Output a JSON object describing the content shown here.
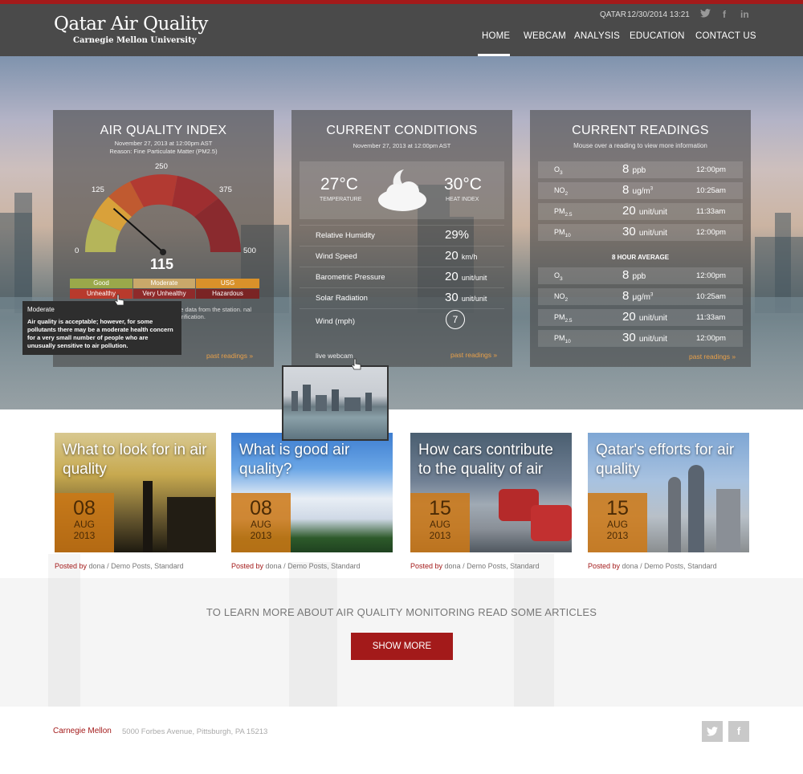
{
  "header": {
    "logo_title": "Qatar Air Quality",
    "logo_subtitle": "Carnegie Mellon University",
    "country": "QATAR",
    "datetime": "12/30/2014  13:21",
    "nav": [
      "HOME",
      "WEBCAM",
      "ANALYSIS",
      "EDUCATION",
      "CONTACT US"
    ],
    "active_nav": "HOME",
    "social_icons": [
      "twitter-icon",
      "facebook-icon",
      "linkedin-icon"
    ]
  },
  "aqi_panel": {
    "title": "AIR QUALITY INDEX",
    "date": "November 27, 2013 at 12:00pm AST",
    "reason": "Reason: Fine Particulate Matter (PM2.5)",
    "gauge_ticks": [
      "0",
      "125",
      "250",
      "375",
      "500"
    ],
    "value": "115",
    "value_number": 115,
    "gauge_max": 500,
    "legend": [
      {
        "label": "Good",
        "color": "#9aa84a"
      },
      {
        "label": "Moderate",
        "color": "#c9a86a"
      },
      {
        "label": "USG",
        "color": "#d9912a"
      },
      {
        "label": "Unhealthy",
        "color": "#b83a2c"
      },
      {
        "label": "Very Unhealthy",
        "color": "#8e2a2a"
      },
      {
        "label": "Hazardous",
        "color": "#7a2424"
      }
    ],
    "background_text": "me data from the station. nal verification.",
    "past_readings": "past readings »"
  },
  "tooltip": {
    "title": "Moderate",
    "body": "Air quality is acceptable; however, for some pollutants there may be a moderate health concern for a very small number of people who are unusually sensitive to air pollution."
  },
  "conditions_panel": {
    "title": "CURRENT CONDITIONS",
    "date": "November 27, 2013 at 12:00pm AST",
    "temperature": "27°C",
    "temperature_label": "TEMPERATURE",
    "heat_index": "30°C",
    "heat_index_label": "HEAT INDEX",
    "weather_icon": "moon-cloud-icon",
    "rows": [
      {
        "name": "Relative Humidity",
        "value": "29%",
        "unit": ""
      },
      {
        "name": "Wind Speed",
        "value": "20",
        "unit": "km/h"
      },
      {
        "name": "Barometric Pressure",
        "value": "20",
        "unit": "unit/unit"
      },
      {
        "name": "Solar Radiation",
        "value": "30",
        "unit": "unit/unit"
      }
    ],
    "wind_label": "Wind (mph)",
    "wind_value": "7",
    "live_webcam": "live webcam",
    "past_readings": "past readings »"
  },
  "readings_panel": {
    "title": "CURRENT READINGS",
    "subtitle": "Mouse over a reading to view more information",
    "current": [
      {
        "p": "O",
        "s": "3",
        "v": "8",
        "u": "ppb",
        "sup": "",
        "t": "12:00pm"
      },
      {
        "p": "NO",
        "s": "2",
        "v": "8",
        "u": "ug/m",
        "sup": "3",
        "t": "10:25am"
      },
      {
        "p": "PM",
        "s": "2.5",
        "v": "20",
        "u": "unit/unit",
        "sup": "",
        "t": "11:33am"
      },
      {
        "p": "PM",
        "s": "10",
        "v": "30",
        "u": "unit/unit",
        "sup": "",
        "t": "12:00pm"
      }
    ],
    "avg_header": "8 HOUR AVERAGE",
    "average": [
      {
        "p": "O",
        "s": "3",
        "v": "8",
        "u": "ppb",
        "sup": "",
        "t": "12:00pm"
      },
      {
        "p": "NO",
        "s": "2",
        "v": "8",
        "u": "μg/m",
        "sup": "3",
        "t": "10:25am"
      },
      {
        "p": "PM",
        "s": "2.5",
        "v": "20",
        "u": "unit/unit",
        "sup": "",
        "t": "11:33am"
      },
      {
        "p": "PM",
        "s": "10",
        "v": "30",
        "u": "unit/unit",
        "sup": "",
        "t": "12:00pm"
      }
    ],
    "past_readings": "past readings »"
  },
  "articles": [
    {
      "title": "What to look for in air quality",
      "day": "08",
      "month": "AUG",
      "year": "2013",
      "posted_by": "Posted by",
      "meta": "dona / Demo Posts, Standard"
    },
    {
      "title": "What is good air quality?",
      "day": "08",
      "month": "AUG",
      "year": "2013",
      "posted_by": "Posted by",
      "meta": "dona / Demo Posts, Standard"
    },
    {
      "title": "How cars contribute to the quality of air",
      "day": "15",
      "month": "AUG",
      "year": "2013",
      "posted_by": "Posted by",
      "meta": "dona / Demo Posts, Standard"
    },
    {
      "title": "Qatar's efforts for air quality",
      "day": "15",
      "month": "AUG",
      "year": "2013",
      "posted_by": "Posted by",
      "meta": "dona / Demo Posts, Standard"
    }
  ],
  "learn_more": "TO LEARN MORE ABOUT AIR QUALITY MONITORING READ SOME ARTICLES",
  "show_more": "SHOW MORE",
  "footer": {
    "org": "Carnegie Mellon",
    "address": "5000 Forbes Avenue, Pittsburgh, PA 15213",
    "social_icons": [
      "twitter-icon",
      "facebook-icon"
    ]
  },
  "colors": {
    "brand_red": "#a31a1a",
    "date_orange": "#ce7814",
    "link_orange": "#e8a14a"
  }
}
